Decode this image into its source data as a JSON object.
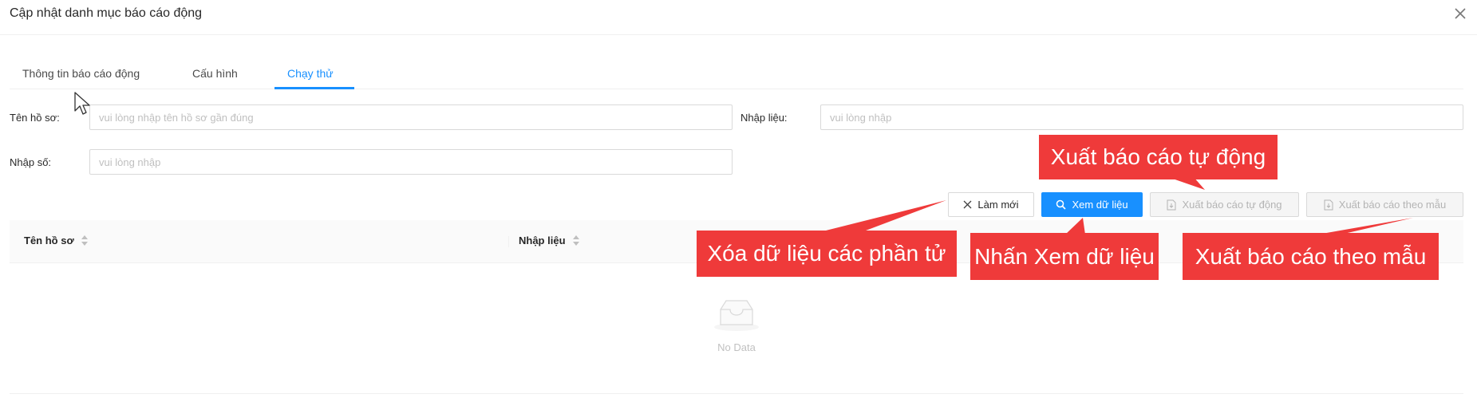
{
  "modal": {
    "title": "Cập nhật danh mục báo cáo động",
    "close_icon": "close-icon"
  },
  "tabs": [
    {
      "label": "Thông tin báo cáo động",
      "active": false
    },
    {
      "label": "Cấu hình",
      "active": false
    },
    {
      "label": "Chạy thử",
      "active": true
    }
  ],
  "form": {
    "profile_name": {
      "label": "Tên hồ sơ:",
      "value": "",
      "placeholder": "vui lòng nhập tên hồ sơ gần đúng"
    },
    "data_entry": {
      "label": "Nhập liệu:",
      "value": "",
      "placeholder": "vui lòng nhập"
    },
    "number_entry": {
      "label": "Nhập số:",
      "value": "",
      "placeholder": "vui lòng nhập"
    }
  },
  "toolbar": {
    "reset_label": "Làm mới",
    "reset_icon": "close-icon",
    "view_label": "Xem dữ liệu",
    "view_icon": "search-icon",
    "export_auto_label": "Xuất báo cáo tự động",
    "export_auto_icon": "file-export-icon",
    "export_template_label": "Xuất báo cáo theo mẫu",
    "export_template_icon": "file-export-icon"
  },
  "table": {
    "columns": [
      "Tên hồ sơ",
      "Nhập liệu"
    ],
    "rows": [],
    "empty_text": "No Data",
    "empty_icon": "empty-inbox-icon"
  },
  "annotations": {
    "export_auto": "Xuất báo cáo tự động",
    "clear": "Xóa dữ liệu các phần tử",
    "view": "Nhấn Xem dữ liệu",
    "export_template": "Xuất báo cáo theo mẫu",
    "color": "#ef3a3a"
  },
  "colors": {
    "primary": "#1890ff",
    "annotation": "#ef3a3a"
  }
}
